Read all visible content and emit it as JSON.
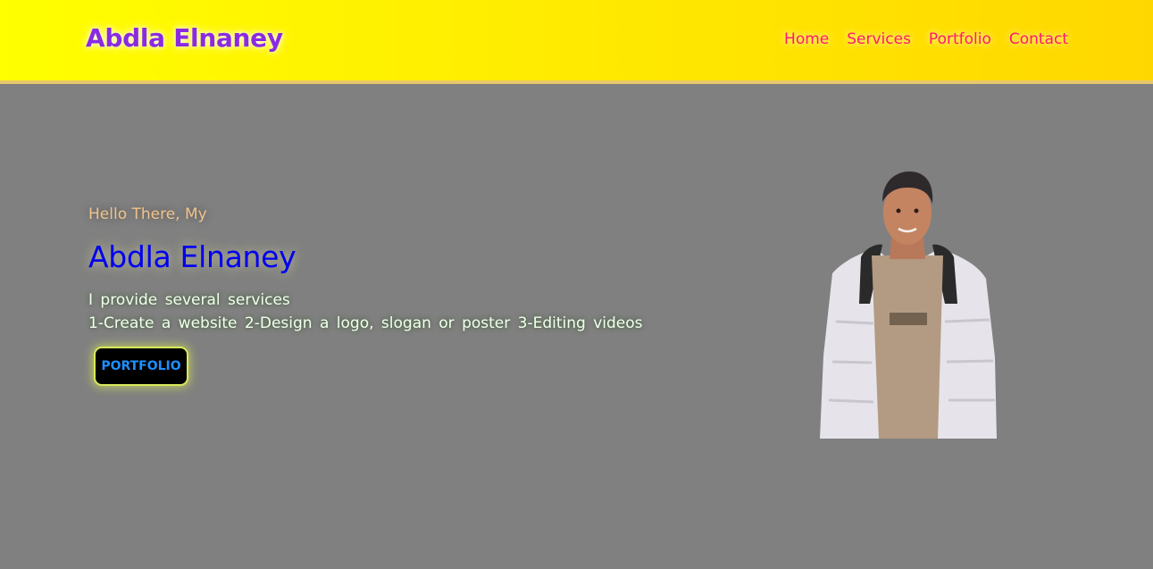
{
  "header": {
    "brand": "Abdla Elnaney",
    "nav": [
      "Home",
      "Services",
      "Portfolio",
      "Contact"
    ]
  },
  "hero": {
    "greeting": "Hello There, My",
    "name": "Abdla Elnaney",
    "description_line1": "I provide several services",
    "description_line2": "1-Create a website 2-Design a logo, slogan or poster 3-Editing videos",
    "button_label": "PORTFOLIO"
  },
  "colors": {
    "header_bg": "#ffff00",
    "brand": "#8a2be2",
    "nav_link": "#ff1a6b",
    "page_bg": "#808080",
    "greeting": "#f2c28a",
    "hero_name": "#0000ee",
    "button_text": "#1e90ff"
  }
}
